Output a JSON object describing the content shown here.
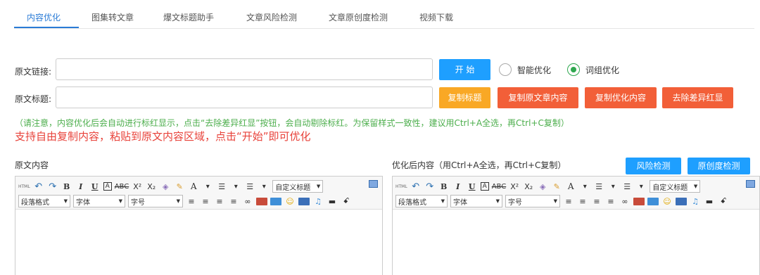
{
  "tabs": [
    {
      "label": "内容优化",
      "active": true
    },
    {
      "label": "图集转文章",
      "active": false
    },
    {
      "label": "爆文标题助手",
      "active": false
    },
    {
      "label": "文章风险检测",
      "active": false
    },
    {
      "label": "文章原创度检测",
      "active": false
    },
    {
      "label": "视频下载",
      "active": false
    }
  ],
  "form": {
    "url_label": "原文链接:",
    "url_value": "",
    "title_label": "原文标题:",
    "title_value": "",
    "start_button": "开 始",
    "radio_smart": "智能优化",
    "radio_word": "词组优化",
    "selected_mode": "词组优化",
    "copy_title_button": "复制标题",
    "copy_original_button": "复制原文章内容",
    "copy_optimized_button": "复制优化内容",
    "remove_diff_button": "去除差异红显"
  },
  "note": "（请注意，内容优化后会自动进行标红显示，点击“去除差异红显”按钮，会自动剔除标红。为保留样式一致性，建议用Ctrl+A全选，再Ctrl+C复制）",
  "highlight": "支持自由复制内容，粘贴到原文内容区域，点击“开始”即可优化",
  "left_editor": {
    "label": "原文内容"
  },
  "right_editor": {
    "label": "优化后内容（用Ctrl+A全选，再Ctrl+C复制）",
    "risk_button": "风险检测",
    "originality_button": "原创度检测"
  },
  "toolbar": {
    "html": "HTML",
    "bold": "B",
    "italic": "I",
    "underline": "U",
    "border_a": "A",
    "strike": "ABC",
    "superscript": "X²",
    "subscript": "X₂",
    "font_color": "A",
    "custom_heading": "自定义标题",
    "paragraph_format": "段落格式",
    "font_family": "字体",
    "font_size": "字号"
  },
  "colors": {
    "accent": "#2a7bd6",
    "blue_button": "#1e9fff",
    "orange_button": "#f9a825",
    "red_button": "#f25f38",
    "note_green": "#4cae4c",
    "highlight_red": "#e8423a"
  }
}
